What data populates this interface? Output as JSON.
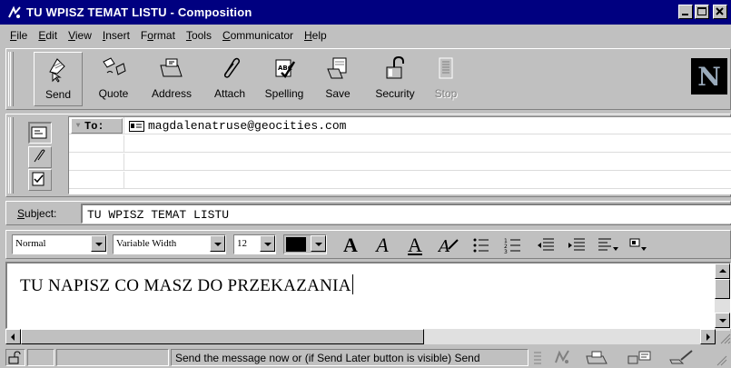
{
  "window": {
    "title": "TU WPISZ TEMAT LISTU - Composition",
    "controls": [
      "minimize-icon",
      "maximize-icon",
      "close-icon"
    ]
  },
  "menu": [
    {
      "label": "File",
      "key": "F",
      "rest": "ile"
    },
    {
      "label": "Edit",
      "key": "E",
      "rest": "dit"
    },
    {
      "label": "View",
      "key": "V",
      "rest": "iew"
    },
    {
      "label": "Insert",
      "key": "I",
      "rest": "nsert"
    },
    {
      "label": "Format",
      "pre": "F",
      "key": "o",
      "rest": "rmat"
    },
    {
      "label": "Tools",
      "key": "T",
      "rest": "ools"
    },
    {
      "label": "Communicator",
      "key": "C",
      "rest": "ommunicator"
    },
    {
      "label": "Help",
      "key": "H",
      "rest": "elp"
    }
  ],
  "toolbar": {
    "send": "Send",
    "quote": "Quote",
    "address": "Address",
    "attach": "Attach",
    "spelling": "Spelling",
    "save": "Save",
    "security": "Security",
    "stop": "Stop",
    "logo": "N"
  },
  "addressing": {
    "type_label": "To:",
    "recipient": "magdalenatruse@geocities.com"
  },
  "subject": {
    "label_key": "S",
    "label_rest": "ubject:",
    "value": "TU WPISZ TEMAT LISTU"
  },
  "format": {
    "paragraph_style": "Normal",
    "font": "Variable Width",
    "size": "12",
    "text_color": "#000000"
  },
  "body": {
    "text": "TU NAPISZ CO MASZ DO PRZEKAZANIA"
  },
  "status": {
    "text": "Send the message now  or (if Send Later button is visible) Send"
  },
  "colors": {
    "titlebar": "#000080",
    "face": "#c0c0c0"
  }
}
